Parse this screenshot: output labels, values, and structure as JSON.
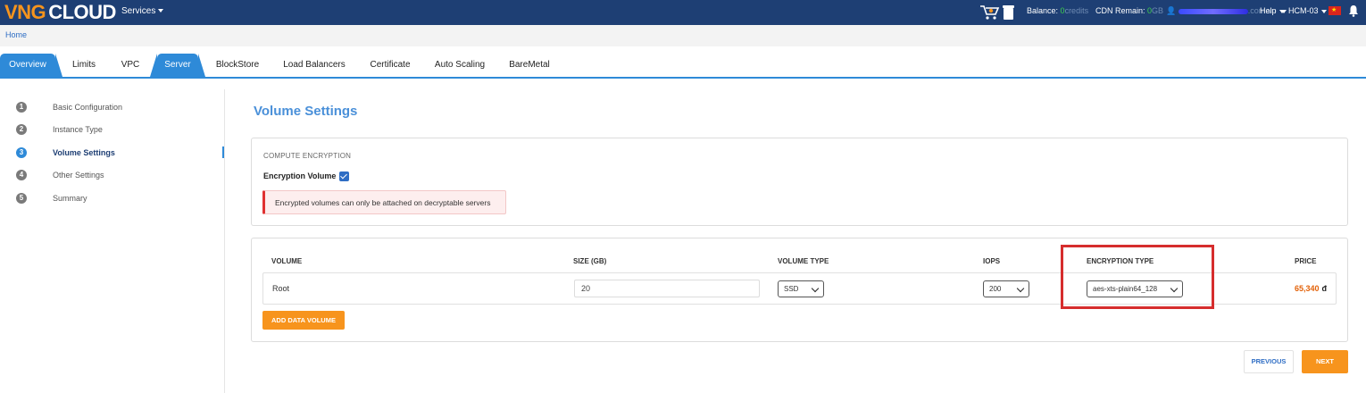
{
  "topbar": {
    "logo_part1": "VNG",
    "logo_part2": "CLOUD",
    "services_label": "Services",
    "balance_label": "Balance:",
    "balance_value": "0",
    "balance_unit": "credits",
    "cdn_label": "CDN Remain:",
    "cdn_value": "0",
    "cdn_unit": "GB",
    "user_suffix": ".com.vn",
    "help_label": "Help",
    "region_label": "HCM-03",
    "icons": [
      "cart-icon",
      "bucket-icon",
      "user-icon",
      "vn-flag-icon",
      "bell-icon"
    ]
  },
  "breadcrumb": {
    "home": "Home"
  },
  "tabs": [
    {
      "label": "Overview",
      "active": true
    },
    {
      "label": "Limits",
      "active": false
    },
    {
      "label": "VPC",
      "active": false
    },
    {
      "label": "Server",
      "active": true
    },
    {
      "label": "BlockStore",
      "active": false
    },
    {
      "label": "Load Balancers",
      "active": false
    },
    {
      "label": "Certificate",
      "active": false
    },
    {
      "label": "Auto Scaling",
      "active": false
    },
    {
      "label": "BareMetal",
      "active": false
    }
  ],
  "steps": [
    {
      "num": "1",
      "label": "Basic Configuration"
    },
    {
      "num": "2",
      "label": "Instance Type"
    },
    {
      "num": "3",
      "label": "Volume Settings",
      "active": true
    },
    {
      "num": "4",
      "label": "Other Settings"
    },
    {
      "num": "5",
      "label": "Summary"
    }
  ],
  "main": {
    "title": "Volume Settings",
    "encryption": {
      "section_header": "COMPUTE ENCRYPTION",
      "checkbox_label": "Encryption Volume",
      "checked": true,
      "alert": "Encrypted volumes can only be attached on decryptable servers"
    },
    "volume_table": {
      "headers": {
        "volume": "VOLUME",
        "size": "SIZE (GB)",
        "volume_type": "VOLUME TYPE",
        "iops": "IOPS",
        "encryption_type": "ENCRYPTION TYPE",
        "price": "PRICE"
      },
      "row": {
        "volume": "Root",
        "size": "20",
        "volume_type": "SSD",
        "iops": "200",
        "encryption_type": "aes-xts-plain64_128",
        "price": "65,340",
        "currency": "đ"
      },
      "add_button": "ADD DATA VOLUME"
    },
    "previous_button": "PREVIOUS",
    "next_button": "NEXT"
  },
  "colors": {
    "navbar": "#1e3f74",
    "accent_blue": "#2e8ad8",
    "orange": "#f7941d",
    "price": "#e36209",
    "highlight_red": "#d62d2d"
  }
}
